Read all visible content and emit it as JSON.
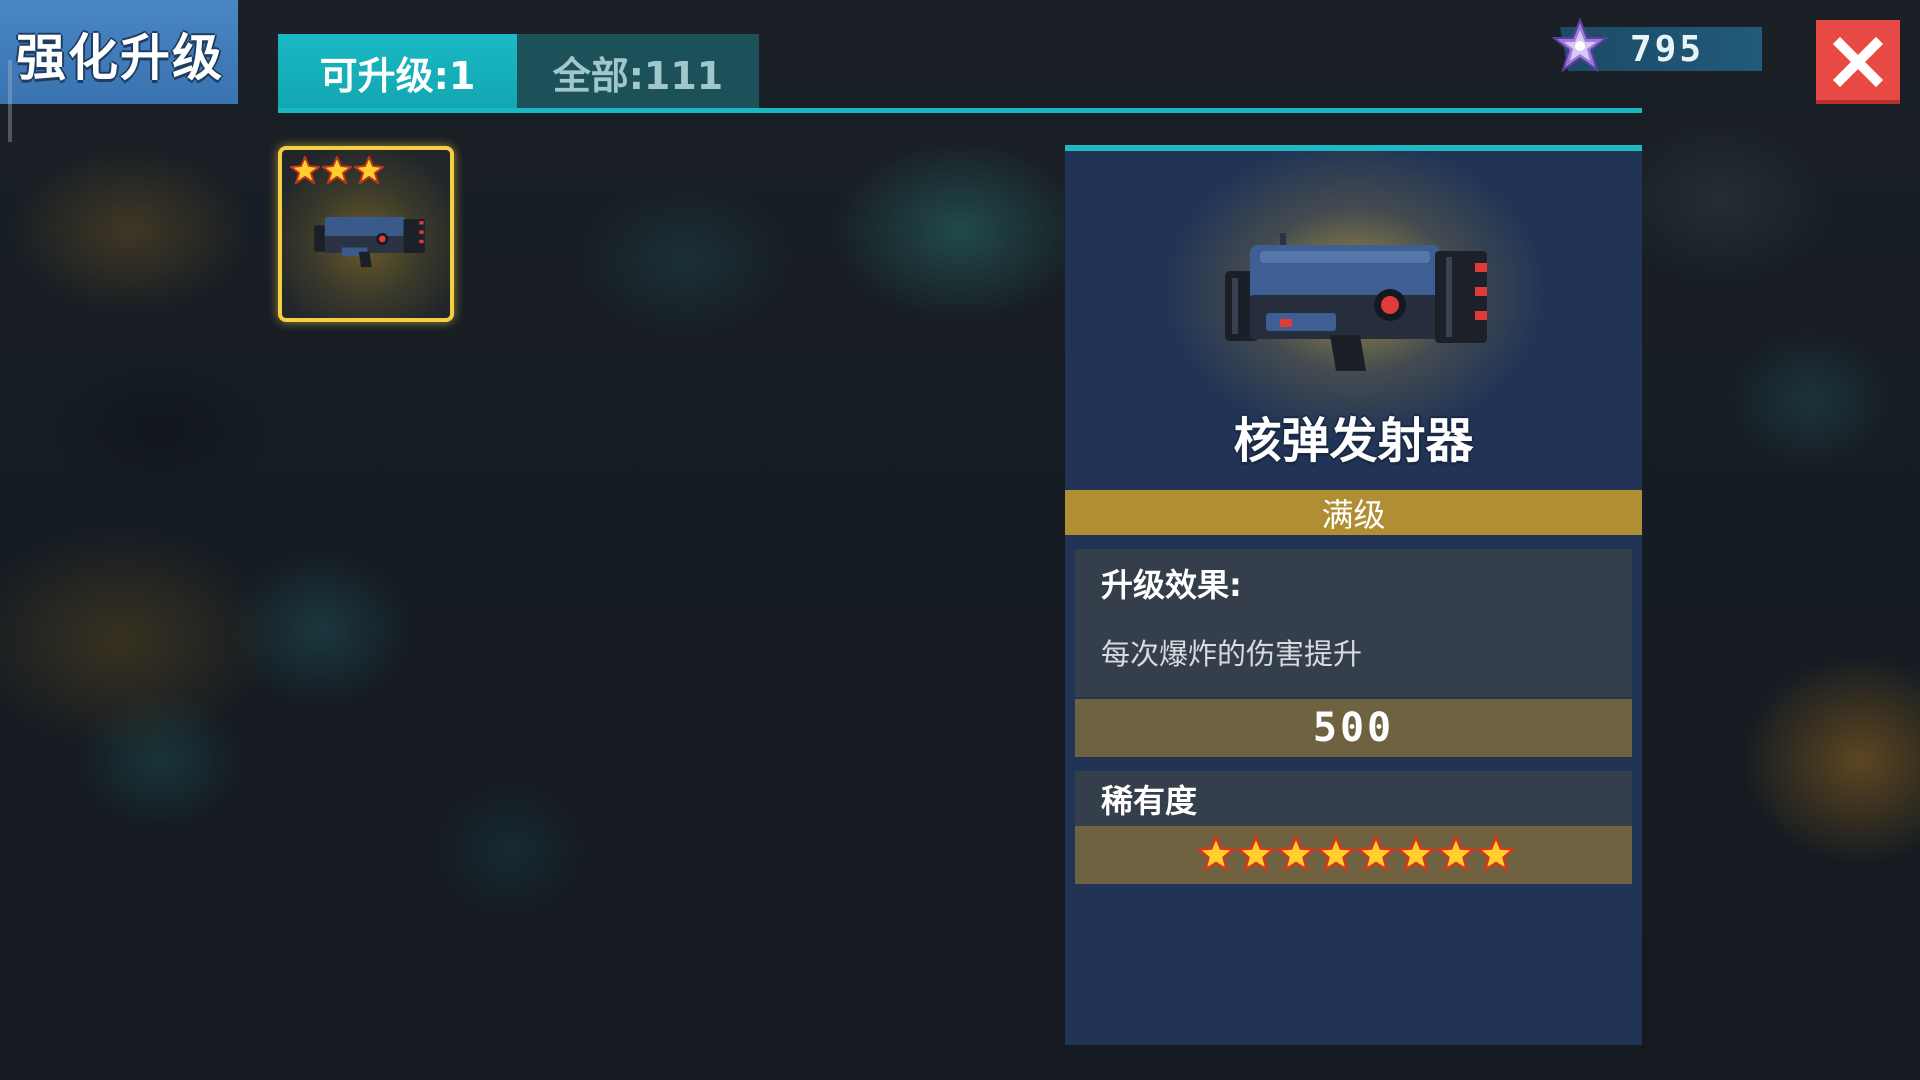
{
  "header": {
    "title": "强化升级"
  },
  "tabs": [
    {
      "label": "可升级:1",
      "active": true
    },
    {
      "label": "全部:111",
      "active": false
    }
  ],
  "currency": {
    "icon": "purple-star-gem-icon",
    "value": "795"
  },
  "close": {
    "icon": "close-icon",
    "color": "#e74a45"
  },
  "inventory": {
    "items": [
      {
        "name": "核弹发射器",
        "stars": 3,
        "selected": true,
        "icon": "launcher-icon"
      }
    ]
  },
  "detail": {
    "name": "核弹发射器",
    "level_status": "满级",
    "effect_label": "升级效果:",
    "effect_description": "每次爆炸的伤害提升",
    "effect_value": "500",
    "rarity_label": "稀有度",
    "rarity_stars": 8
  },
  "colors": {
    "accent": "#19b9c4",
    "gold": "#b08e34",
    "panel": "#213456",
    "star": "#ffcf2e"
  }
}
